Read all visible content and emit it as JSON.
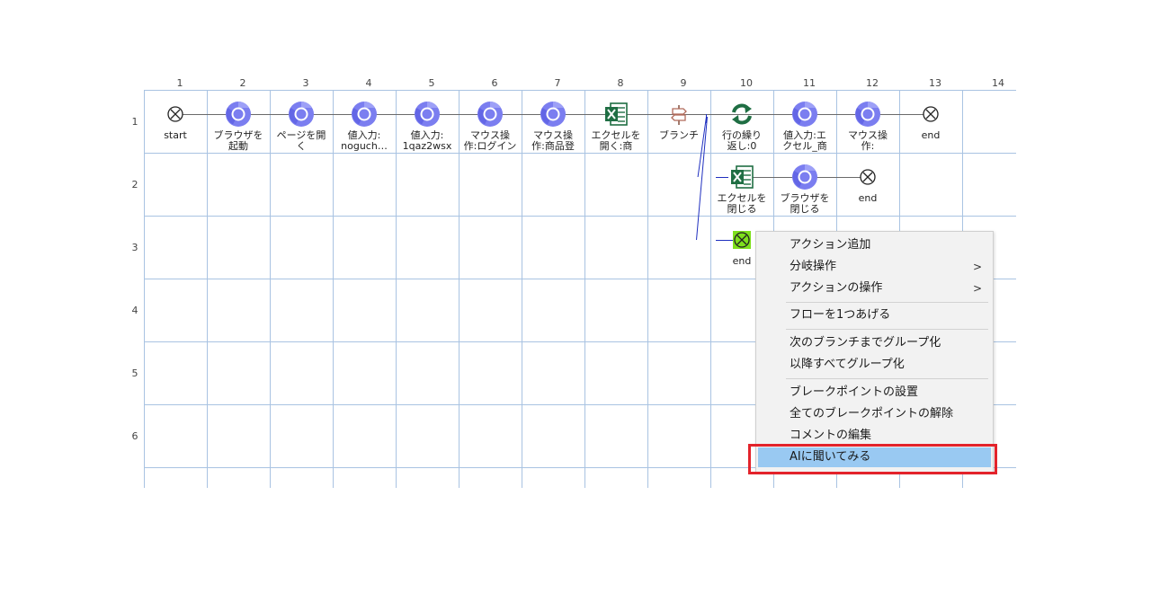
{
  "columns": [
    "1",
    "2",
    "3",
    "4",
    "5",
    "6",
    "7",
    "8",
    "9",
    "10",
    "11",
    "12",
    "13",
    "14"
  ],
  "rows": [
    "1",
    "2",
    "3",
    "4",
    "5",
    "6"
  ],
  "nodes": {
    "r1c1": {
      "label": "start",
      "icon": "end-circle-icon"
    },
    "r1c2": {
      "label": "ブラウザを\n起動",
      "icon": "chrome-icon"
    },
    "r1c3": {
      "label": "ページを開\nく",
      "icon": "chrome-icon"
    },
    "r1c4": {
      "label": "値入力:\nnoguch…",
      "icon": "chrome-icon"
    },
    "r1c5": {
      "label": "値入力:\n1qaz2wsx",
      "icon": "chrome-icon"
    },
    "r1c6": {
      "label": "マウス操\n作:ログイン",
      "icon": "chrome-icon"
    },
    "r1c7": {
      "label": "マウス操\n作:商品登",
      "icon": "chrome-icon"
    },
    "r1c8": {
      "label": "エクセルを\n開く:商",
      "icon": "excel-icon"
    },
    "r1c9": {
      "label": "ブランチ",
      "icon": "branch-icon"
    },
    "r1c10": {
      "label": "行の繰り\n返し:0",
      "icon": "loop-icon"
    },
    "r1c11": {
      "label": "値入力:エ\nクセル_商",
      "icon": "chrome-icon"
    },
    "r1c12": {
      "label": "マウス操\n作:",
      "icon": "chrome-icon"
    },
    "r1c13": {
      "label": "end",
      "icon": "end-circle-icon"
    },
    "r2c10": {
      "label": "エクセルを\n閉じる",
      "icon": "excel-icon"
    },
    "r2c11": {
      "label": "ブラウザを\n閉じる",
      "icon": "chrome-icon"
    },
    "r2c12": {
      "label": "end",
      "icon": "end-circle-icon"
    },
    "r3c10": {
      "label": "end",
      "icon": "end-circle-green-icon"
    }
  },
  "context_menu": {
    "items": [
      {
        "label": "アクション追加",
        "submenu": false
      },
      {
        "label": "分岐操作",
        "submenu": true
      },
      {
        "label": "アクションの操作",
        "submenu": true
      },
      {
        "label": "フローを1つあげる",
        "submenu": false
      },
      {
        "label": "次のブランチまでグループ化",
        "submenu": false
      },
      {
        "label": "以降すべてグループ化",
        "submenu": false
      },
      {
        "label": "ブレークポイントの設置",
        "submenu": false
      },
      {
        "label": "全てのブレークポイントの解除",
        "submenu": false
      },
      {
        "label": "コメントの編集",
        "submenu": false
      },
      {
        "label": "AIに聞いてみる",
        "submenu": false,
        "highlighted": true
      }
    ],
    "submenu_arrow": ">"
  },
  "colors": {
    "grid": "#a9c3e2",
    "chrome": "#7b7ef0",
    "excel": "#1f6e43",
    "loop": "#1f6e43",
    "highlight": "#99c9f2",
    "annotation_box": "#e3232b",
    "branch_line": "#1f2fbf",
    "end_green": "#7ee01c"
  }
}
